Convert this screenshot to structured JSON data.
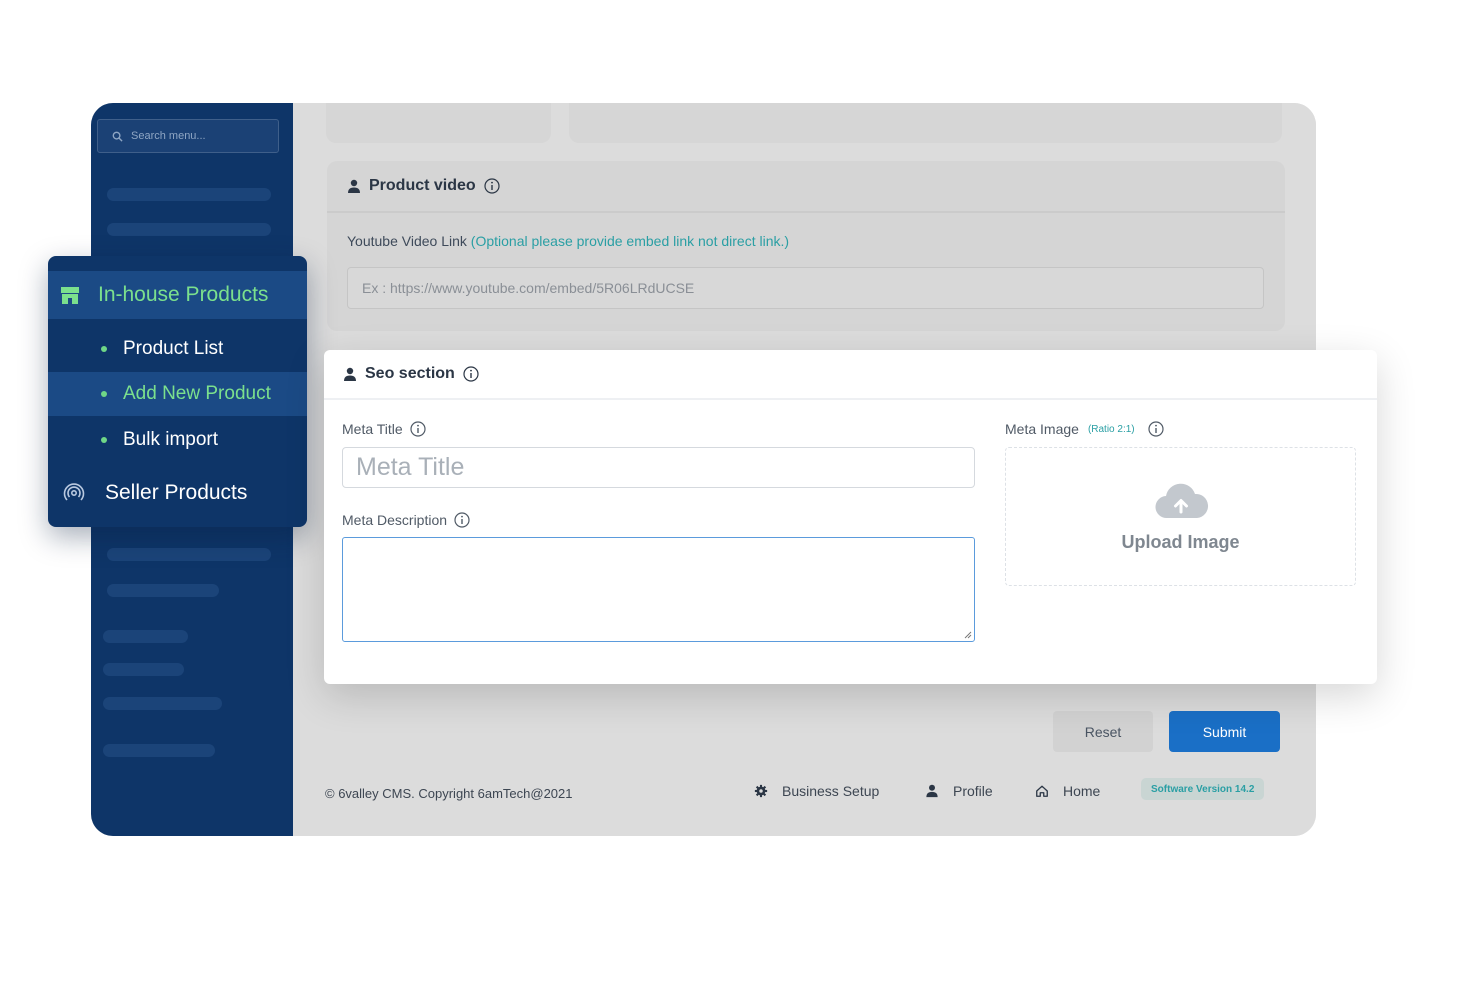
{
  "sidebar": {
    "search_placeholder": "Search menu..."
  },
  "menu": {
    "section_label": "In-house Products",
    "items": [
      {
        "label": "Product List"
      },
      {
        "label": "Add New Product"
      },
      {
        "label": "Bulk import"
      }
    ],
    "seller_label": "Seller Products",
    "active_color": "#7be08d"
  },
  "product_video": {
    "title": "Product video",
    "link_label": "Youtube Video Link",
    "link_hint": "(Optional please provide embed link not direct link.)",
    "placeholder": "Ex : https://www.youtube.com/embed/5R06LRdUCSE"
  },
  "seo": {
    "title": "Seo section",
    "meta_title_label": "Meta Title",
    "meta_title_placeholder": "Meta Title",
    "meta_description_label": "Meta Description",
    "meta_description_value": "",
    "meta_image_label": "Meta Image",
    "meta_image_ratio": "(Ratio 2:1)",
    "upload_text": "Upload Image"
  },
  "actions": {
    "reset_label": "Reset",
    "submit_label": "Submit"
  },
  "footer": {
    "copyright": "© 6valley CMS. Copyright 6amTech@2021",
    "business_setup": "Business Setup",
    "profile": "Profile",
    "home": "Home",
    "version": "Software Version 14.2"
  },
  "colors": {
    "sidebar_bg": "#0e3568",
    "accent_green": "#7be08d",
    "submit_blue": "#1a6fc6",
    "hint_teal": "#2a9fa4"
  }
}
